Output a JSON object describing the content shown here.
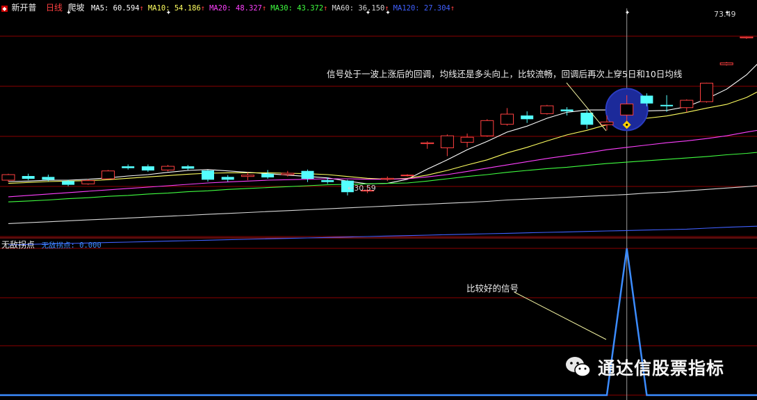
{
  "header": {
    "title": "新开普",
    "period": "日线",
    "indicator_name": "爬坡",
    "ma_items": [
      {
        "label": "MA5: 60.594",
        "color": "#ffffff"
      },
      {
        "label": "MA10: 54.186",
        "color": "#ffff60"
      },
      {
        "label": "MA20: 48.327",
        "color": "#ff40ff"
      },
      {
        "label": "MA30: 43.372",
        "color": "#40ff40"
      },
      {
        "label": "MA60: 36.150",
        "color": "#d8d8d8"
      },
      {
        "label": "MA120: 27.304",
        "color": "#4060ff"
      }
    ],
    "up_arrow": "↑"
  },
  "colors": {
    "up_candle": "#ff4040",
    "down_candle": "#54ffff",
    "grid": "#8b0000",
    "signal_line": "#3c8cff",
    "circle": "#1c2a9a",
    "marker": "#ffd000"
  },
  "annotations": {
    "low_label": "←30.59",
    "high_label": "73.49",
    "main_note": "信号处于一波上涨后的回调，均线还是多头向上，比较流畅，回调后再次上穿5日和10日均线",
    "sub_note": "比较好的信号"
  },
  "sub_header": {
    "panel_title": "无敌拐点",
    "series_label": "无敌拐点: 0.000"
  },
  "watermark": {
    "text": "通达信股票指标",
    "icon": "wechat-icon"
  },
  "chart_data": [
    {
      "type": "candlestick",
      "title": "新开普 日线",
      "ylim": [
        25,
        75
      ],
      "candles": [
        {
          "o": 37.2,
          "c": 38.4,
          "h": 38.6,
          "l": 36.8
        },
        {
          "o": 38.1,
          "c": 37.5,
          "h": 38.6,
          "l": 37.2
        },
        {
          "o": 37.9,
          "c": 37.3,
          "h": 38.4,
          "l": 37.0
        },
        {
          "o": 37.0,
          "c": 36.2,
          "h": 37.3,
          "l": 35.9
        },
        {
          "o": 36.4,
          "c": 37.1,
          "h": 37.4,
          "l": 36.2
        },
        {
          "o": 37.5,
          "c": 39.2,
          "h": 39.4,
          "l": 37.4
        },
        {
          "o": 40.2,
          "c": 39.8,
          "h": 40.6,
          "l": 39.5
        },
        {
          "o": 40.2,
          "c": 39.3,
          "h": 40.6,
          "l": 39.0
        },
        {
          "o": 39.4,
          "c": 40.2,
          "h": 40.5,
          "l": 39.1
        },
        {
          "o": 40.2,
          "c": 39.7,
          "h": 40.5,
          "l": 39.4
        },
        {
          "o": 39.3,
          "c": 37.3,
          "h": 39.4,
          "l": 36.9
        },
        {
          "o": 37.9,
          "c": 37.3,
          "h": 38.3,
          "l": 36.9
        },
        {
          "o": 38.0,
          "c": 38.3,
          "h": 38.9,
          "l": 37.2
        },
        {
          "o": 38.6,
          "c": 37.8,
          "h": 39.4,
          "l": 37.5
        },
        {
          "o": 38.4,
          "c": 38.7,
          "h": 39.2,
          "l": 38.0
        },
        {
          "o": 39.2,
          "c": 37.5,
          "h": 39.5,
          "l": 36.8
        },
        {
          "o": 37.2,
          "c": 36.8,
          "h": 37.8,
          "l": 36.4
        },
        {
          "o": 37.1,
          "c": 34.6,
          "h": 37.3,
          "l": 33.9
        },
        {
          "o": 34.9,
          "c": 35.0,
          "h": 35.5,
          "l": 34.4
        },
        {
          "o": 37.4,
          "c": 37.6,
          "h": 38.0,
          "l": 37.0
        },
        {
          "o": 38.2,
          "c": 38.3,
          "h": 38.5,
          "l": 38.0
        },
        {
          "o": 45.1,
          "c": 45.3,
          "h": 45.6,
          "l": 44.0
        },
        {
          "o": 44.2,
          "c": 46.8,
          "h": 47.1,
          "l": 42.4
        },
        {
          "o": 45.4,
          "c": 46.5,
          "h": 47.3,
          "l": 44.3
        },
        {
          "o": 46.8,
          "c": 50.1,
          "h": 50.4,
          "l": 46.6
        },
        {
          "o": 49.3,
          "c": 51.5,
          "h": 52.8,
          "l": 49.0
        },
        {
          "o": 51.2,
          "c": 50.4,
          "h": 52.1,
          "l": 49.6
        },
        {
          "o": 51.6,
          "c": 53.3,
          "h": 53.5,
          "l": 51.4
        },
        {
          "o": 52.5,
          "c": 52.1,
          "h": 53.0,
          "l": 51.2
        },
        {
          "o": 51.8,
          "c": 49.2,
          "h": 52.3,
          "l": 48.3
        },
        {
          "o": 49.2,
          "c": 49.8,
          "h": 51.2,
          "l": 48.0
        },
        {
          "o": 51.3,
          "c": 53.7,
          "h": 55.6,
          "l": 48.7
        },
        {
          "o": 55.5,
          "c": 53.8,
          "h": 56.0,
          "l": 53.2
        },
        {
          "o": 53.5,
          "c": 53.2,
          "h": 55.6,
          "l": 52.0
        },
        {
          "o": 52.9,
          "c": 54.5,
          "h": 54.7,
          "l": 51.9
        },
        {
          "o": 54.2,
          "c": 58.2,
          "h": 58.3,
          "l": 54.0
        },
        {
          "o": 62.2,
          "c": 62.6,
          "h": 62.8,
          "l": 62.0
        },
        {
          "o": 68.0,
          "c": 68.2,
          "h": 68.3,
          "l": 67.8
        },
        {
          "o": 72.1,
          "c": 72.2,
          "h": 73.49,
          "l": 69.5
        }
      ],
      "ma_lines": [
        {
          "name": "MA5",
          "color": "#ffffff",
          "values": [
            36.9,
            37.0,
            37.2,
            37.2,
            37.4,
            37.7,
            38.1,
            38.4,
            38.9,
            39.3,
            39.5,
            39.2,
            38.9,
            38.6,
            38.3,
            38.0,
            37.7,
            37.0,
            36.4,
            36.5,
            37.4,
            39.6,
            41.6,
            43.8,
            45.6,
            47.6,
            48.9,
            50.6,
            51.9,
            52.4,
            52.4,
            52.4,
            52.2,
            52.3,
            53.1,
            54.8,
            56.9,
            60.0,
            64.3
          ]
        },
        {
          "name": "MA10",
          "color": "#ffff60",
          "values": [
            36.5,
            36.7,
            36.9,
            37.0,
            37.1,
            37.3,
            37.6,
            37.9,
            38.2,
            38.5,
            38.7,
            38.8,
            38.8,
            38.8,
            38.7,
            38.6,
            38.4,
            38.0,
            37.6,
            37.4,
            37.6,
            38.3,
            39.3,
            40.5,
            41.6,
            43.1,
            44.3,
            45.7,
            47.0,
            48.0,
            49.2,
            49.9,
            50.6,
            51.1,
            51.9,
            52.8,
            53.6,
            55.1,
            57.3
          ]
        },
        {
          "name": "MA20",
          "color": "#ff40ff",
          "values": [
            33.6,
            33.9,
            34.2,
            34.5,
            34.8,
            35.1,
            35.4,
            35.7,
            36.0,
            36.3,
            36.6,
            36.8,
            37.0,
            37.2,
            37.3,
            37.4,
            37.5,
            37.5,
            37.4,
            37.4,
            37.5,
            37.9,
            38.4,
            39.1,
            39.8,
            40.5,
            41.2,
            41.9,
            42.5,
            43.1,
            43.8,
            44.3,
            44.8,
            45.3,
            45.7,
            46.2,
            46.8,
            47.6,
            48.3
          ]
        },
        {
          "name": "MA30",
          "color": "#40ff40",
          "values": [
            32.5,
            32.7,
            32.9,
            33.2,
            33.4,
            33.7,
            33.9,
            34.2,
            34.4,
            34.7,
            34.9,
            35.2,
            35.4,
            35.6,
            35.8,
            36.0,
            36.2,
            36.3,
            36.4,
            36.5,
            36.6,
            37.0,
            37.5,
            38.0,
            38.4,
            38.9,
            39.3,
            39.7,
            40.0,
            40.4,
            40.8,
            41.1,
            41.4,
            41.7,
            42.0,
            42.3,
            42.7,
            43.0,
            43.4
          ]
        },
        {
          "name": "MA60",
          "color": "#d8d8d8",
          "values": [
            27.8,
            28.0,
            28.2,
            28.4,
            28.6,
            28.8,
            29.0,
            29.2,
            29.4,
            29.6,
            29.8,
            30.0,
            30.2,
            30.4,
            30.6,
            30.8,
            31.0,
            31.2,
            31.4,
            31.6,
            31.8,
            32.0,
            32.2,
            32.4,
            32.6,
            32.9,
            33.1,
            33.3,
            33.5,
            33.7,
            33.9,
            34.1,
            34.4,
            34.6,
            34.9,
            35.2,
            35.5,
            35.8,
            36.15
          ]
        },
        {
          "name": "MA120",
          "color": "#4060ff",
          "values": [
            23.2,
            23.3,
            23.4,
            23.5,
            23.6,
            23.7,
            23.8,
            23.9,
            24.0,
            24.1,
            24.2,
            24.3,
            24.4,
            24.5,
            24.6,
            24.7,
            24.8,
            24.9,
            25.0,
            25.1,
            25.2,
            25.3,
            25.4,
            25.5,
            25.6,
            25.7,
            25.8,
            25.9,
            26.0,
            26.1,
            26.2,
            26.3,
            26.4,
            26.5,
            26.6,
            26.8,
            27.0,
            27.15,
            27.304
          ]
        }
      ]
    },
    {
      "type": "line",
      "title": "无敌拐点",
      "series": [
        {
          "name": "无敌拐点",
          "color": "#3c8cff",
          "values": [
            0,
            0,
            0,
            0,
            0,
            0,
            0,
            0,
            0,
            0,
            0,
            0,
            0,
            0,
            0,
            0,
            0,
            0,
            0,
            0,
            0,
            0,
            0,
            0,
            0,
            0,
            0,
            0,
            0,
            0,
            0,
            1,
            0,
            0,
            0,
            0,
            0,
            0,
            0
          ]
        }
      ],
      "ylim": [
        0,
        1
      ]
    }
  ]
}
